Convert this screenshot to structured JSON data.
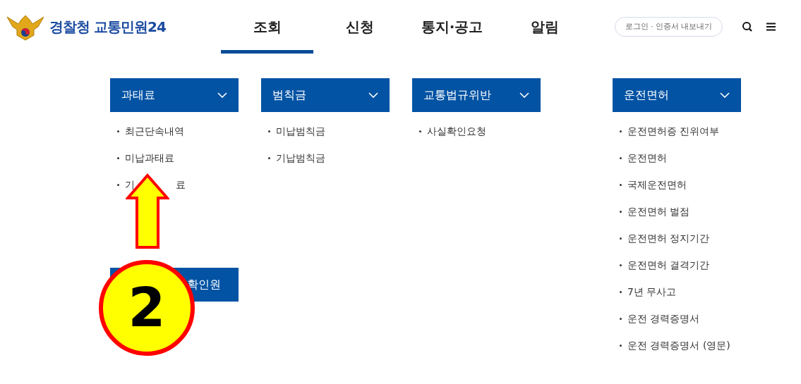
{
  "header": {
    "logo_text": "경찰청 교통민원24",
    "nav": [
      {
        "label": "조회",
        "selected": true
      },
      {
        "label": "신청",
        "selected": false
      },
      {
        "label": "통지·공고",
        "selected": false
      },
      {
        "label": "알림",
        "selected": false
      }
    ],
    "login_button": "로그인 · 인증서 내보내기"
  },
  "menu_columns": [
    {
      "title": "과태료",
      "items": [
        {
          "parts": [
            "최근단속내역"
          ]
        },
        {
          "parts": [
            "미납과태료"
          ]
        },
        {
          "parts": [
            "기",
            "료"
          ]
        }
      ],
      "button": "확인원"
    },
    {
      "title": "범칙금",
      "items": [
        {
          "parts": [
            "미납범칙금"
          ]
        },
        {
          "parts": [
            "기납범칙금"
          ]
        }
      ]
    },
    {
      "title": "교통법규위반",
      "items": [
        {
          "parts": [
            "사실확인요청"
          ]
        }
      ]
    },
    {
      "title": "운전면허",
      "items": [
        {
          "parts": [
            "운전면허증 진위여부"
          ]
        },
        {
          "parts": [
            "운전면허"
          ]
        },
        {
          "parts": [
            "국제운전면허"
          ]
        },
        {
          "parts": [
            "운전면허 벌점"
          ]
        },
        {
          "parts": [
            "운전면허 정지기간"
          ]
        },
        {
          "parts": [
            "운전면허 결격기간"
          ]
        },
        {
          "parts": [
            "7년 무사고"
          ]
        },
        {
          "parts": [
            "운전 경력증명서"
          ]
        },
        {
          "parts": [
            "운전 경력증명서 (영문)"
          ]
        }
      ]
    }
  ],
  "annotation": {
    "step": "2"
  }
}
